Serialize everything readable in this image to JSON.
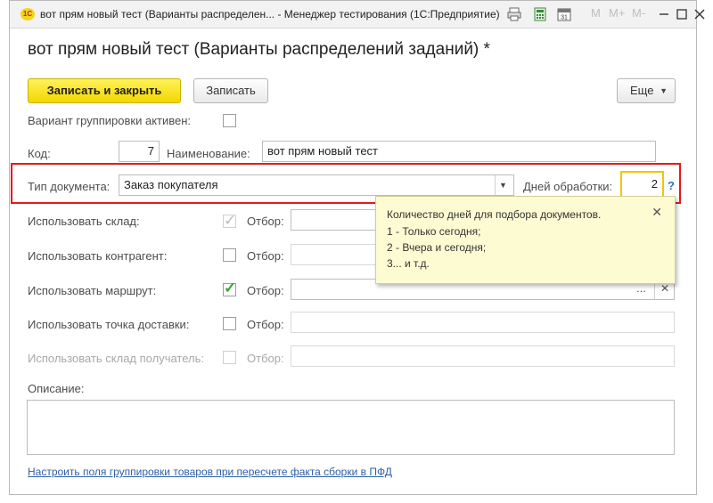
{
  "titlebar": {
    "app_logo": "1С",
    "title": "вот прям новый тест (Варианты распределен... - Менеджер тестирования (1С:Предприятие)",
    "m_label": "M",
    "m_plus_label": "M+",
    "m_minus_label": "M-",
    "date_icon_text": "31"
  },
  "form": {
    "title": "вот прям новый тест (Варианты распределений заданий) *",
    "save_close_label": "Записать и закрыть",
    "save_label": "Записать",
    "more_label": "Еще",
    "grouping_active_label": "Вариант группировки активен:",
    "code_label": "Код:",
    "code_value": "7",
    "name_label": "Наименование:",
    "name_value": "вот прям новый тест",
    "doc_type_label": "Тип документа:",
    "doc_type_value": "Заказ покупателя",
    "days_label": "Дней обработки:",
    "days_value": "2",
    "help_symbol": "?",
    "filter_label": "Отбор:",
    "use_warehouse_label": "Использовать склад:",
    "use_counterparty_label": "Использовать контрагент:",
    "use_route_label": "Использовать маршрут:",
    "use_delivery_point_label": "Использовать точка доставки:",
    "use_receiver_warehouse_label": "Использовать склад получатель:",
    "description_label": "Описание:",
    "link_text": "Настроить поля группировки товаров при пересчете факта сборки в ПФД"
  },
  "tooltip": {
    "line1": "Количество дней для подбора документов.",
    "line2": "1 - Только сегодня;",
    "line3": "2 - Вчера и сегодня;",
    "line4": "3... и т.д."
  },
  "colors": {
    "accent_yellow": "#f3d600",
    "highlight_red": "#e41919",
    "check_green": "#3aa43a",
    "link_blue": "#2d5fa8",
    "tooltip_bg": "#fdfbd2"
  }
}
